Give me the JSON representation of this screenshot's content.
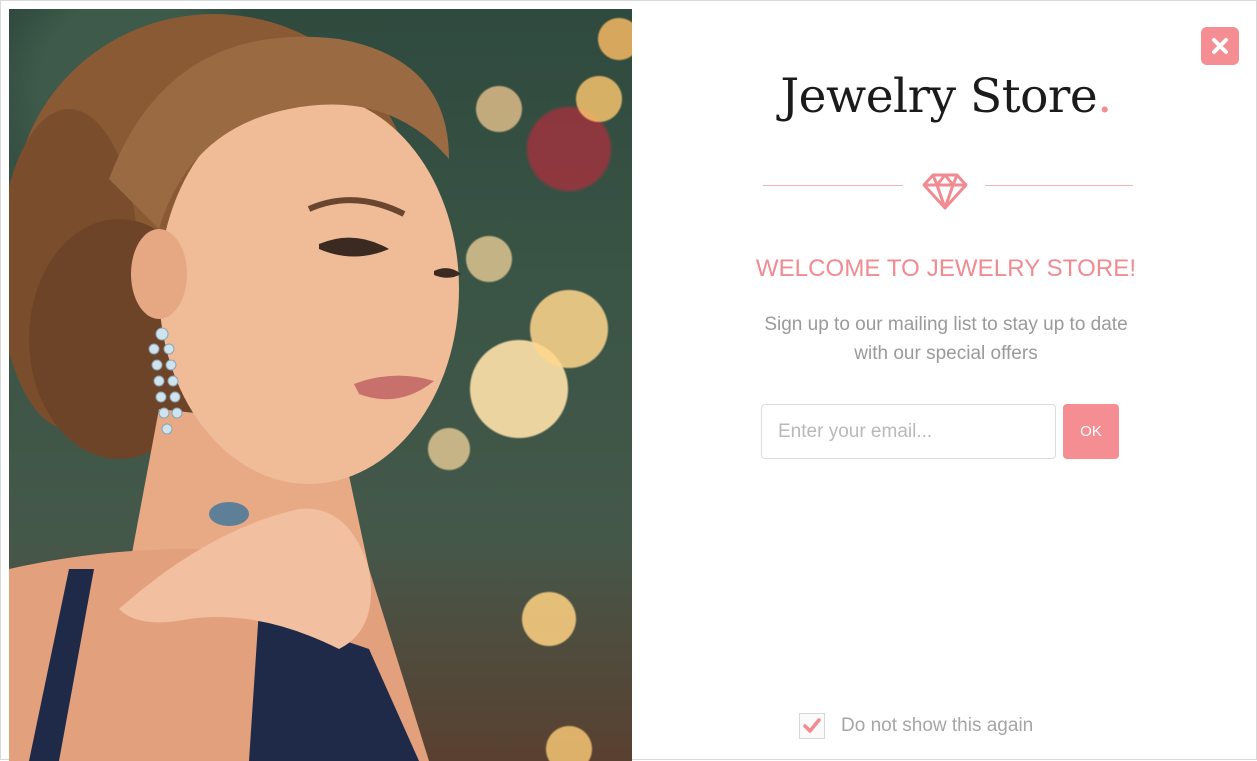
{
  "brand": {
    "name": "Jewelry Store",
    "dot": ".",
    "accent_color": "#f58e92"
  },
  "close_button": {
    "icon": "close-icon"
  },
  "divider": {
    "icon": "diamond-icon"
  },
  "welcome_title": "WELCOME TO JEWELRY STORE!",
  "subtitle": {
    "line1": "Sign up to our mailing list to stay up to date",
    "line2": "with our special offers"
  },
  "signup_form": {
    "email_placeholder": "Enter your email...",
    "email_value": "",
    "submit_label": "OK"
  },
  "dont_show_again": {
    "label": "Do not show this again",
    "checked": true
  },
  "hero_image": {
    "description_icon": "model-photo"
  }
}
